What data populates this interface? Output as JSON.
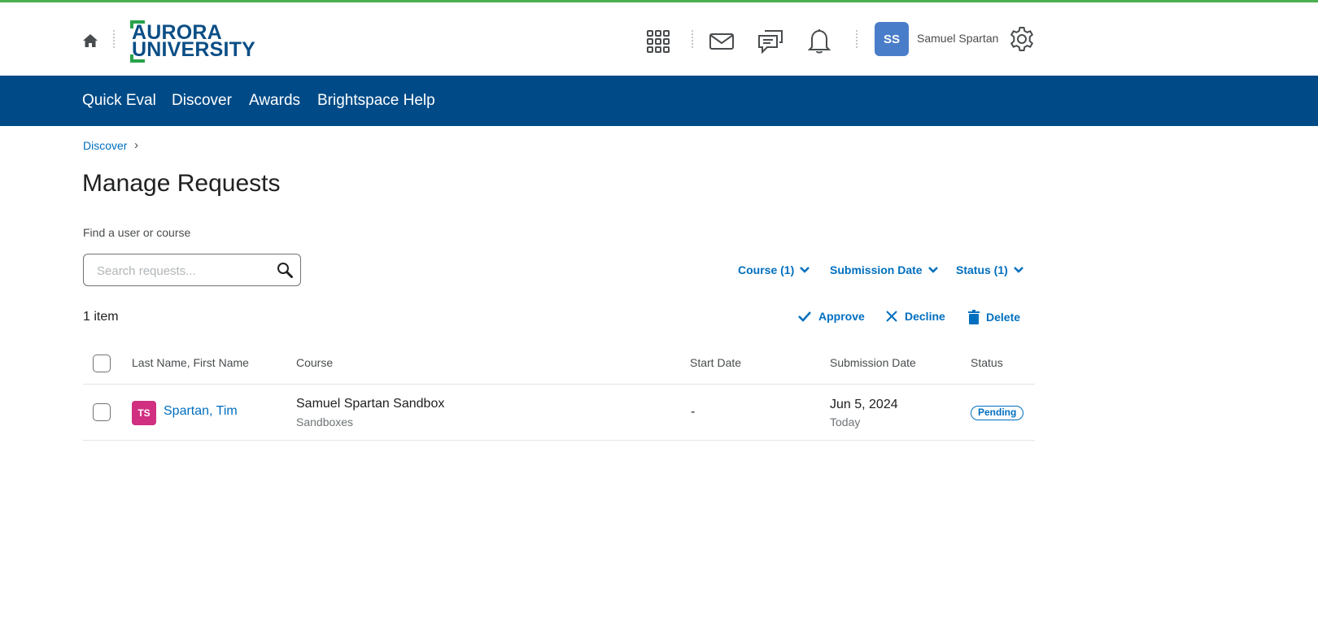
{
  "header": {
    "logo": {
      "line1": "AURORA",
      "line2": "UNIVERSITY"
    },
    "user": {
      "initials": "SS",
      "name": "Samuel Spartan"
    },
    "icons": [
      "home-icon",
      "app-grid-icon",
      "mail-icon",
      "chat-icon",
      "bell-icon",
      "gear-icon"
    ]
  },
  "nav": {
    "items": [
      {
        "label": "Quick Eval"
      },
      {
        "label": "Discover"
      },
      {
        "label": "Awards"
      },
      {
        "label": "Brightspace Help"
      }
    ]
  },
  "breadcrumb": {
    "label": "Discover",
    "separator": "›"
  },
  "page": {
    "title": "Manage Requests"
  },
  "search": {
    "label": "Find a user or course",
    "placeholder": "Search requests...",
    "value": ""
  },
  "filters": [
    {
      "label": "Course (1)"
    },
    {
      "label": "Submission Date"
    },
    {
      "label": "Status (1)"
    }
  ],
  "results": {
    "count": "1 item"
  },
  "actions": [
    {
      "label": "Approve"
    },
    {
      "label": "Decline"
    },
    {
      "label": "Delete"
    }
  ],
  "table": {
    "headers": [
      "Last Name, First Name",
      "Course",
      "Start Date",
      "Submission Date",
      "Status"
    ],
    "rows": [
      {
        "initials": "TS",
        "name": "Spartan, Tim",
        "course": "Samuel Spartan Sandbox",
        "course_sub": "Sandboxes",
        "start_date": "-",
        "submission_date": "Jun 5, 2024",
        "submission_sub": "Today",
        "status": "Pending"
      }
    ]
  },
  "colors": {
    "topline": "#4caf50",
    "navbar": "#004b87",
    "link": "#006fbf",
    "user_avatar": "#4a7dc9",
    "row_avatar": "#d0307f"
  }
}
